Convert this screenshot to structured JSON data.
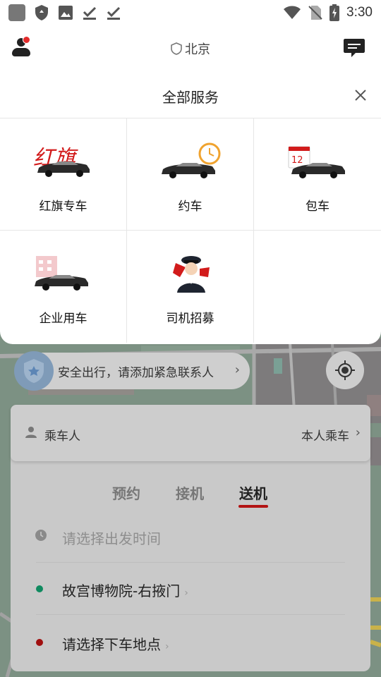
{
  "status_bar": {
    "time": "3:30",
    "icons": [
      "app-icon",
      "shield-icon",
      "image-icon",
      "download-done-icon",
      "download-done-icon",
      "wifi-icon",
      "no-sim-icon",
      "battery-charging-icon"
    ]
  },
  "header": {
    "city": "北京",
    "notification_dot_color": "#e32b2b"
  },
  "services_panel": {
    "title": "全部服务",
    "items": [
      {
        "label": "红旗专车",
        "icon": "hongqi-car-icon"
      },
      {
        "label": "约车",
        "icon": "scheduled-car-icon"
      },
      {
        "label": "包车",
        "icon": "charter-car-icon"
      },
      {
        "label": "企业用车",
        "icon": "enterprise-car-icon"
      },
      {
        "label": "司机招募",
        "icon": "driver-recruit-icon"
      }
    ]
  },
  "safety": {
    "text": "安全出行，请添加紧急联系人"
  },
  "booking": {
    "passenger_label": "乘车人",
    "passenger_value": "本人乘车",
    "tabs": [
      {
        "label": "预约",
        "active": false
      },
      {
        "label": "接机",
        "active": false
      },
      {
        "label": "送机",
        "active": true
      }
    ],
    "time_placeholder": "请选择出发时间",
    "pickup": "故宫博物院-右掖门",
    "dropoff_placeholder": "请选择下车地点",
    "accent_color": "#b31414",
    "pickup_dot_color": "#0f8a5f",
    "dropoff_dot_color": "#a00f0f"
  }
}
